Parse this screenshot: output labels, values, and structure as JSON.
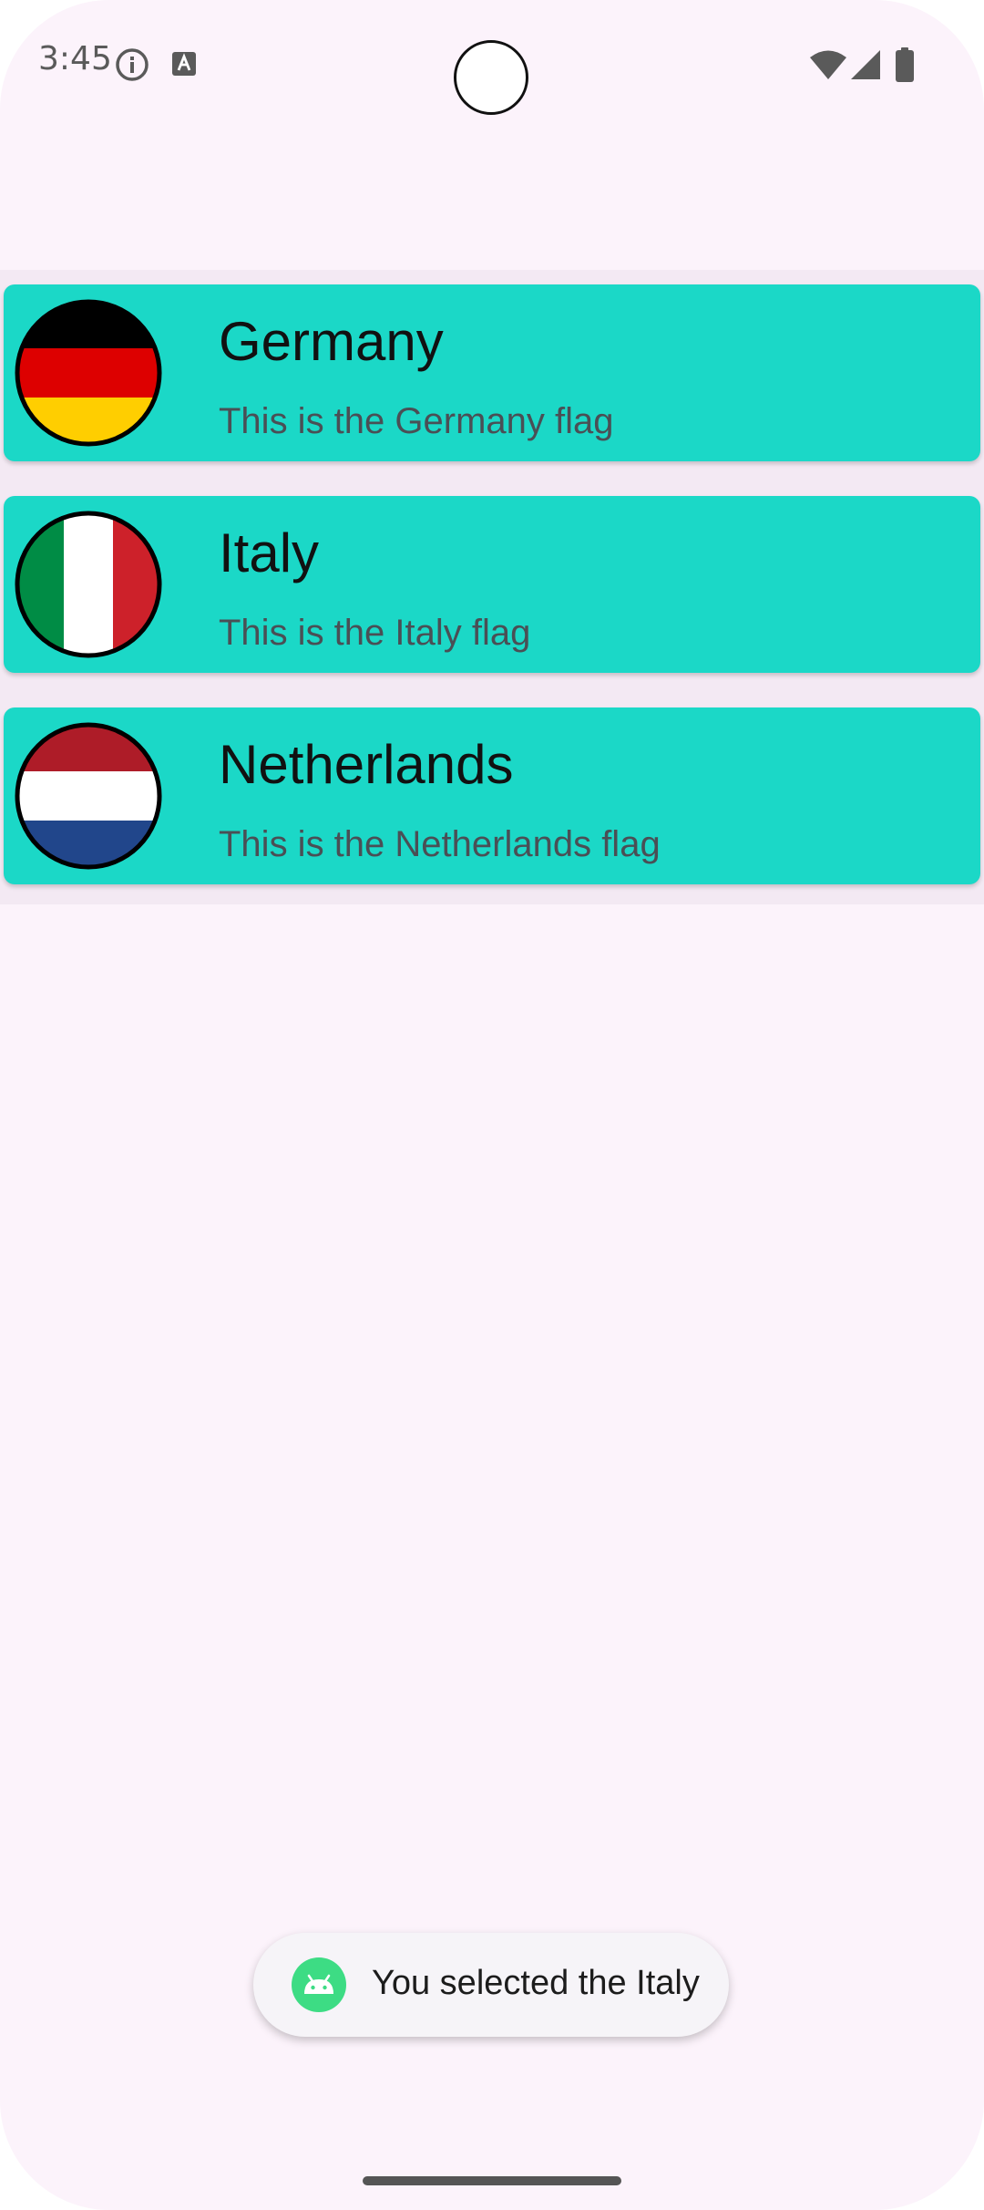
{
  "status_bar": {
    "time": "3:45",
    "icons": [
      "info-icon",
      "text-badge-icon",
      "wifi-icon",
      "signal-icon",
      "battery-icon"
    ]
  },
  "countries": [
    {
      "name": "Germany",
      "subtitle": "This is the Germany flag",
      "flag_colors": [
        "#000000",
        "#dd0000",
        "#ffce00"
      ],
      "flag_orientation": "horizontal"
    },
    {
      "name": "Italy",
      "subtitle": "This is the Italy flag",
      "flag_colors": [
        "#008c45",
        "#ffffff",
        "#cd212a"
      ],
      "flag_orientation": "vertical"
    },
    {
      "name": "Netherlands",
      "subtitle": "This is the Netherlands flag",
      "flag_colors": [
        "#ae1c28",
        "#ffffff",
        "#21468b"
      ],
      "flag_orientation": "horizontal"
    }
  ],
  "toast": {
    "text": "You selected the Italy",
    "icon": "android-icon"
  },
  "colors": {
    "card_background": "#1bd8c7",
    "screen_background": "#fcf3fb",
    "toast_background": "#f6f4f8"
  }
}
